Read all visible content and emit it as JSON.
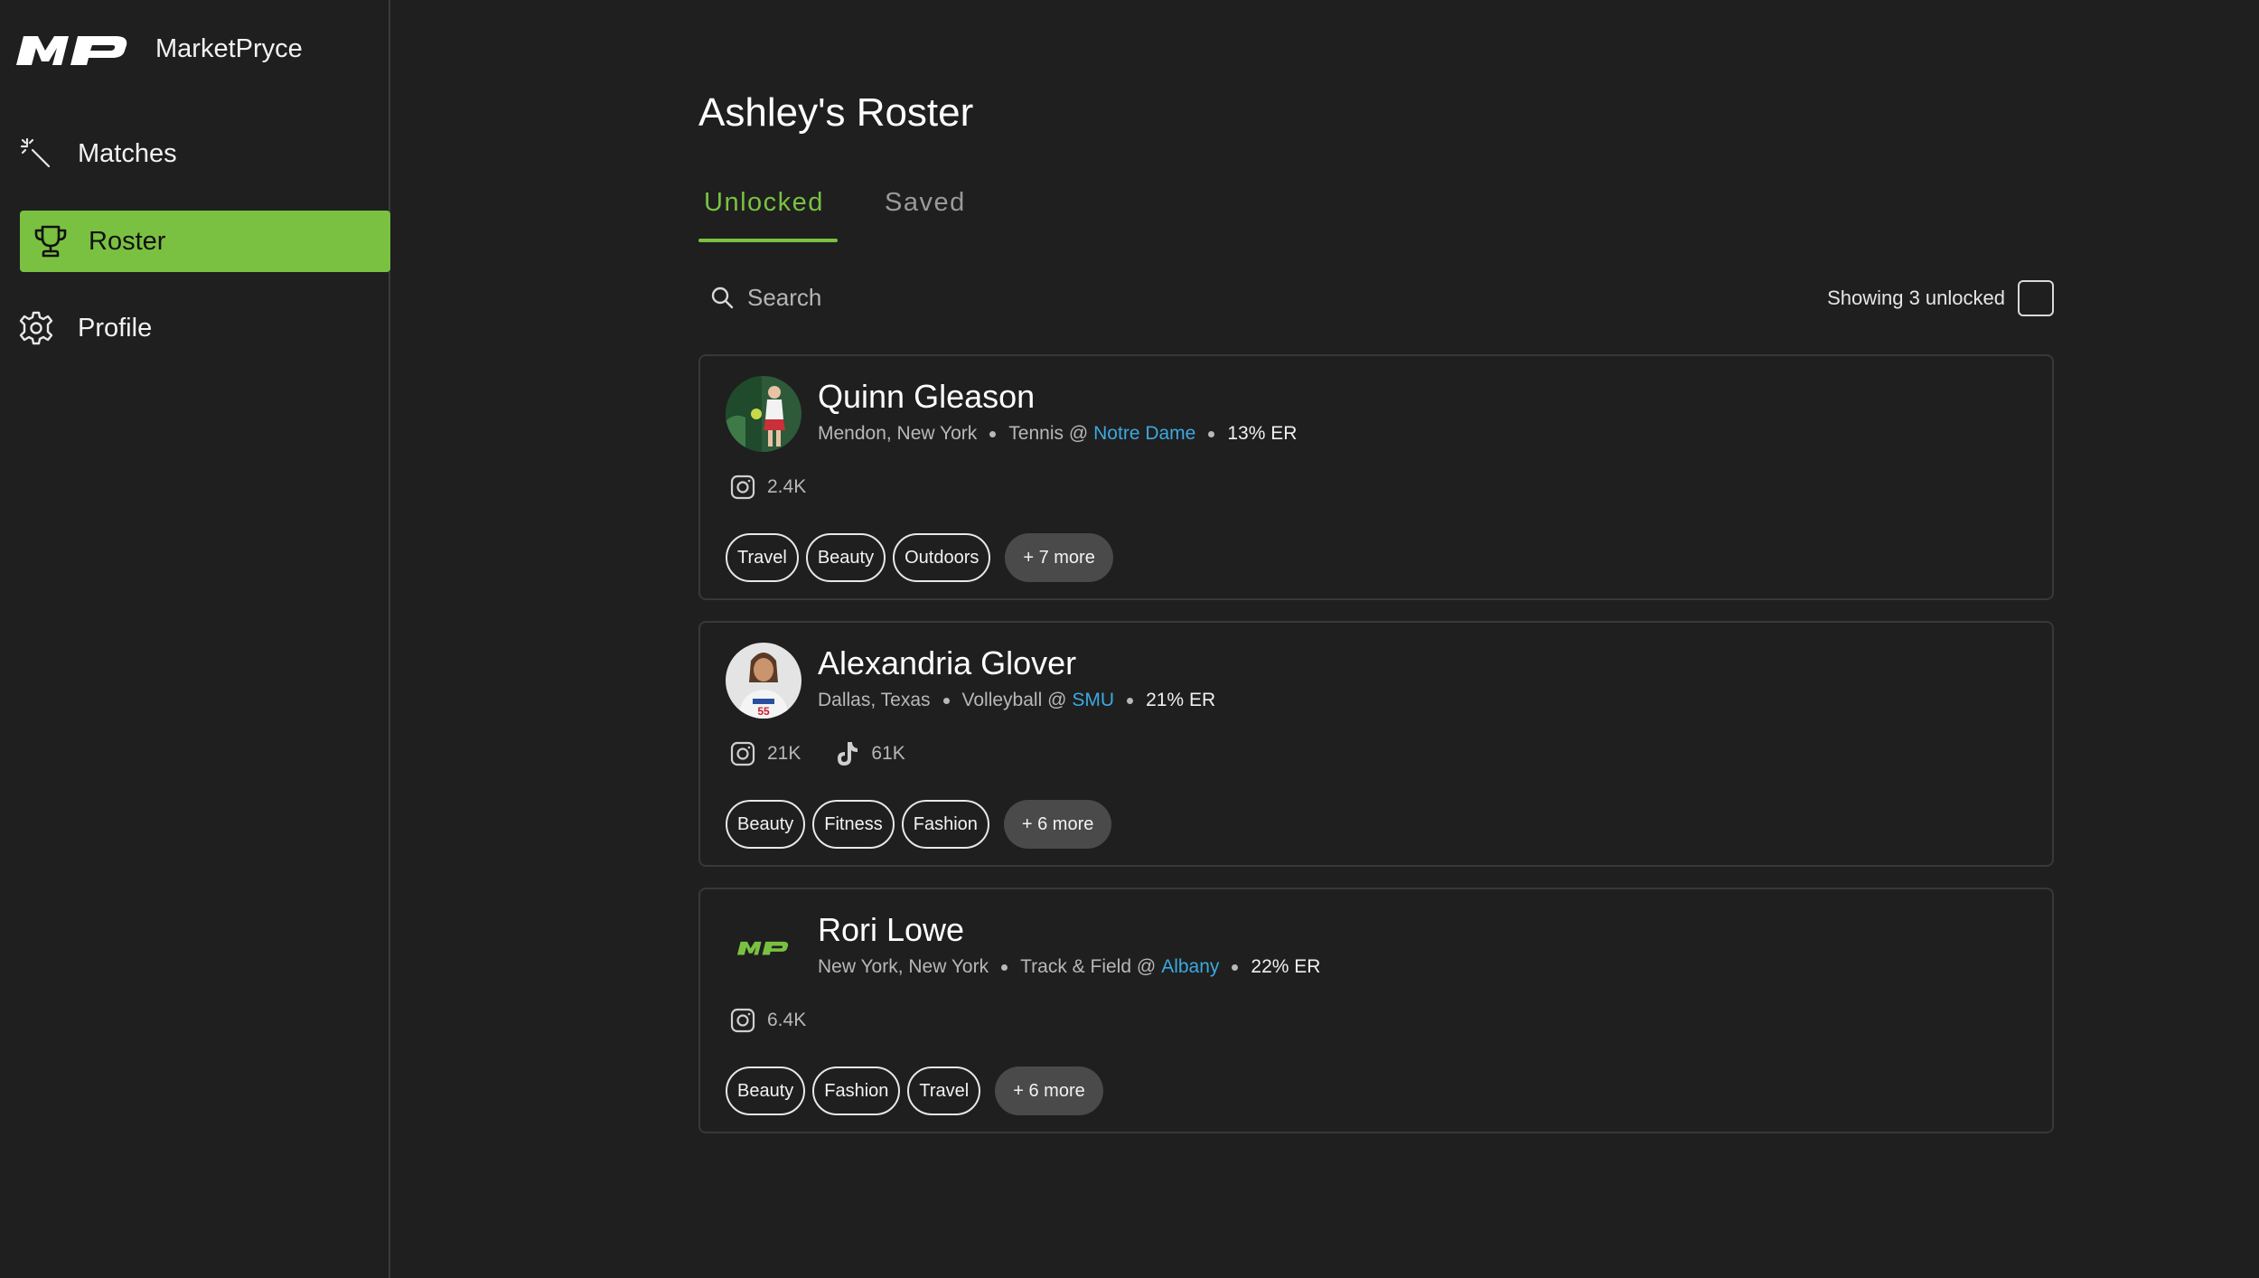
{
  "app": {
    "brand_name": "MarketPryce",
    "logo_text": "MP"
  },
  "sidebar": {
    "items": [
      {
        "label": "Matches",
        "icon": "magic-wand-icon"
      },
      {
        "label": "Roster",
        "icon": "trophy-icon",
        "active": true
      },
      {
        "label": "Profile",
        "icon": "gear-icon"
      }
    ]
  },
  "colors": {
    "accent": "#7ac142",
    "link": "#3ba9e0",
    "background": "#1f1f1f"
  },
  "page": {
    "title": "Ashley's Roster"
  },
  "tabs": [
    {
      "label": "Unlocked",
      "active": true
    },
    {
      "label": "Saved",
      "active": false
    }
  ],
  "search": {
    "placeholder": "Search"
  },
  "filter": {
    "showing_text": "Showing 3 unlocked",
    "checked": false
  },
  "athletes": [
    {
      "name": "Quinn Gleason",
      "location": "Mendon, New York",
      "sport": "Tennis @",
      "school": "Notre Dame",
      "er": "13% ER",
      "avatar": "photo",
      "socials": [
        {
          "icon": "instagram-icon",
          "count": "2.4K"
        }
      ],
      "tags": [
        "Travel",
        "Beauty",
        "Outdoors"
      ],
      "more": "+ 7 more"
    },
    {
      "name": "Alexandria Glover",
      "location": "Dallas, Texas",
      "sport": "Volleyball @",
      "school": "SMU",
      "er": "21% ER",
      "avatar": "photo",
      "socials": [
        {
          "icon": "instagram-icon",
          "count": "21K"
        },
        {
          "icon": "tiktok-icon",
          "count": "61K"
        }
      ],
      "tags": [
        "Beauty",
        "Fitness",
        "Fashion"
      ],
      "more": "+ 6 more"
    },
    {
      "name": "Rori Lowe",
      "location": "New York, New York",
      "sport": "Track & Field @",
      "school": "Albany",
      "er": "22% ER",
      "avatar": "mp-logo",
      "socials": [
        {
          "icon": "instagram-icon",
          "count": "6.4K"
        }
      ],
      "tags": [
        "Beauty",
        "Fashion",
        "Travel"
      ],
      "more": "+ 6 more"
    }
  ]
}
